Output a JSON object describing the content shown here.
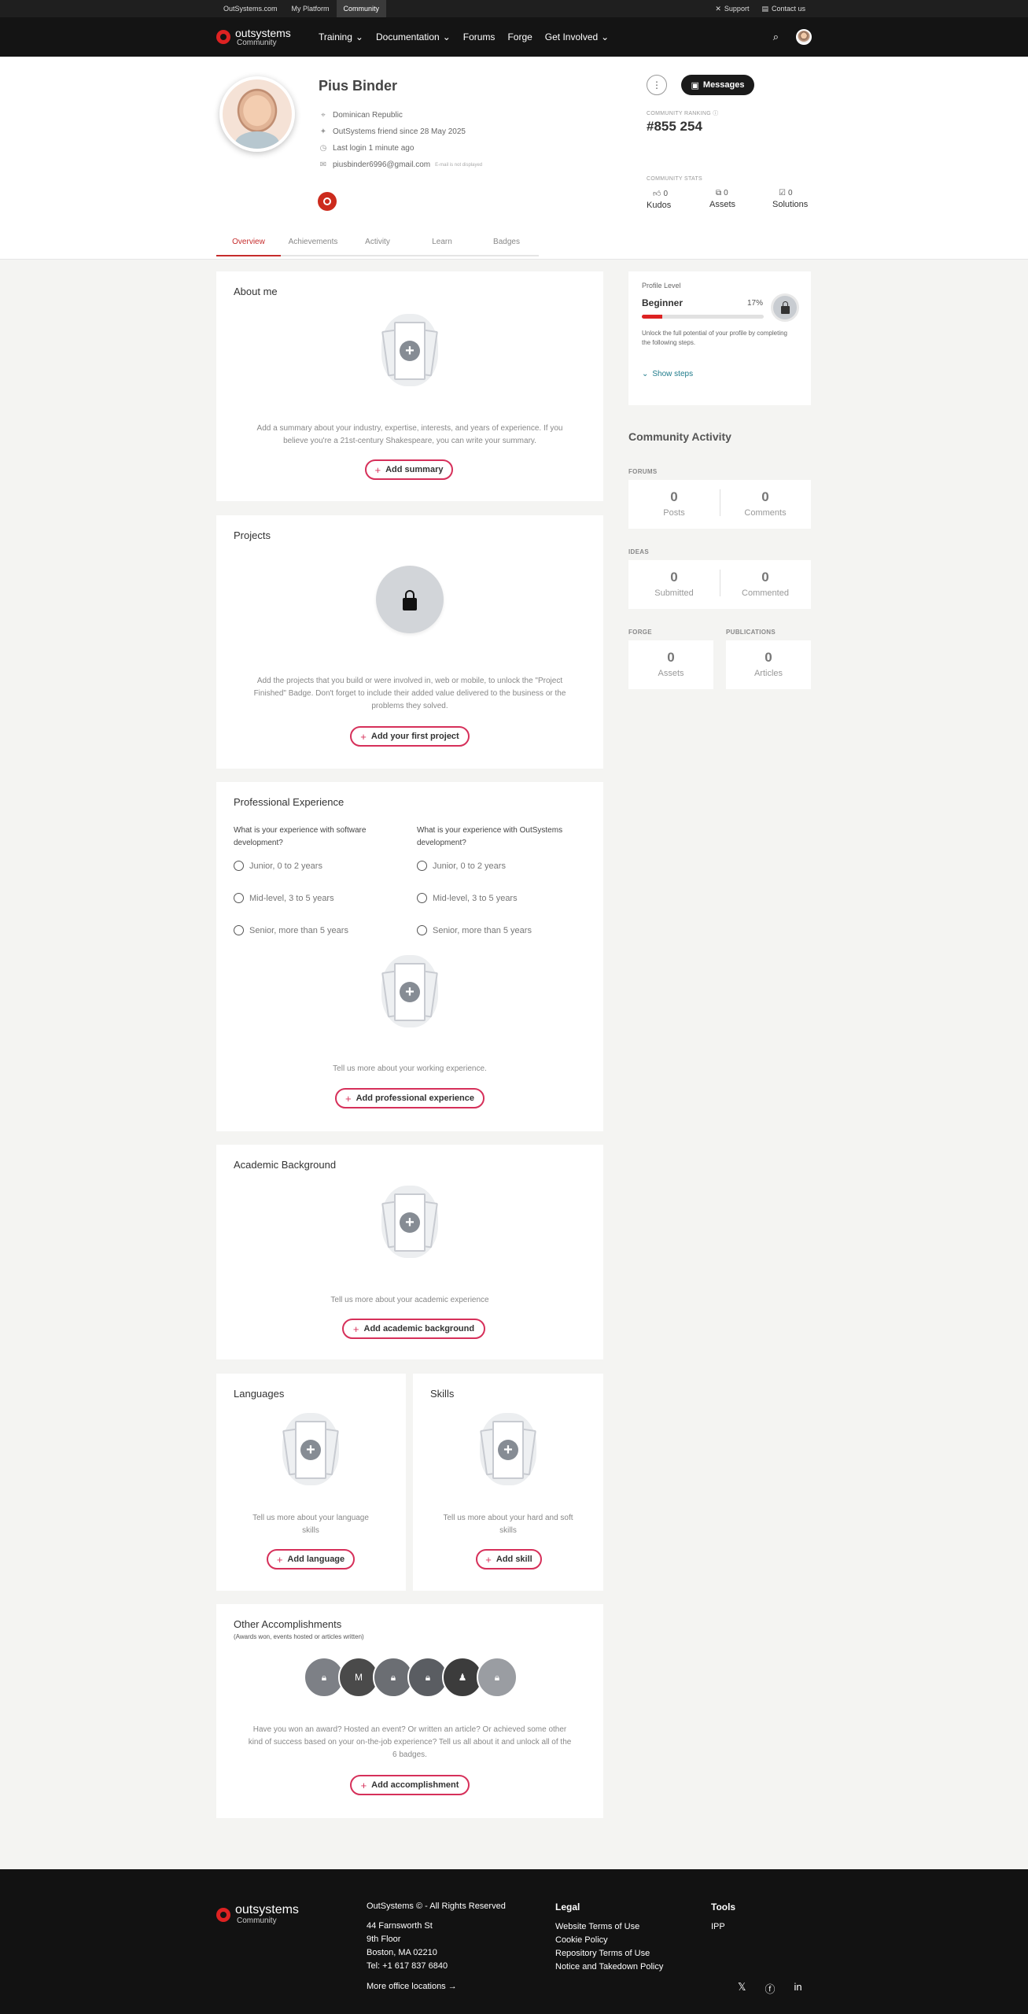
{
  "topbar": {
    "links": [
      "OutSystems.com",
      "My Platform",
      "Community"
    ],
    "right": [
      "Support",
      "Contact us"
    ]
  },
  "nav": {
    "brand": "outsystems",
    "brand_sub": "Community",
    "items": [
      "Training",
      "Documentation",
      "Forums",
      "Forge",
      "Get Involved"
    ]
  },
  "profile": {
    "name": "Pius Binder",
    "country": "Dominican Republic",
    "since": "OutSystems friend since 28 May 2025",
    "last_login": "Last login 1 minute ago",
    "email": "piusbinder6996@gmail.com",
    "email_note": "E-mail is not displayed",
    "messages_label": "Messages",
    "ranking_label": "COMMUNITY RANKING",
    "ranking": "#855 254",
    "stats_label": "COMMUNITY STATS",
    "stats": [
      {
        "count": "0",
        "label": "Kudos"
      },
      {
        "count": "0",
        "label": "Assets"
      },
      {
        "count": "0",
        "label": "Solutions"
      }
    ]
  },
  "tabs": [
    "Overview",
    "Achievements",
    "Activity",
    "Learn",
    "Badges"
  ],
  "about": {
    "title": "About me",
    "desc": "Add a summary about your industry, expertise, interests, and years of experience. If you believe you're a 21st-century Shakespeare, you can write your summary.",
    "button": "Add summary"
  },
  "projects": {
    "title": "Projects",
    "desc": "Add the projects that you build or were involved in, web or mobile, to unlock the \"Project Finished\" Badge. Don't forget to include their added value delivered to the business or the problems they solved.",
    "button": "Add your first project"
  },
  "experience": {
    "title": "Professional Experience",
    "q1": "What is your experience with software development?",
    "q2": "What is your experience with OutSystems development?",
    "options": [
      "Junior, 0 to 2 years",
      "Mid-level, 3 to 5 years",
      "Senior, more than 5 years"
    ],
    "desc": "Tell us more about your working experience.",
    "button": "Add professional experience"
  },
  "academic": {
    "title": "Academic Background",
    "desc": "Tell us more about your academic experience",
    "button": "Add academic background"
  },
  "languages": {
    "title": "Languages",
    "desc": "Tell us more about your language skills",
    "button": "Add language"
  },
  "skills": {
    "title": "Skills",
    "desc": "Tell us more about your hard and soft skills",
    "button": "Add skill"
  },
  "accomplishments": {
    "title": "Other Accomplishments",
    "sub": "(Awards won, events hosted or articles written)",
    "desc": "Have you won an award? Hosted an event? Or written an article? Or achieved some other kind of success based on your on-the-job experience? Tell us all about it and unlock all of the 6 badges.",
    "button": "Add accomplishment"
  },
  "profile_level": {
    "label": "Profile Level",
    "level": "Beginner",
    "percent": "17%",
    "progress": 0.17,
    "desc": "Unlock the full potential of your profile by completing the following steps.",
    "show_steps": "Show steps"
  },
  "community_activity": {
    "title": "Community Activity",
    "forums_label": "FORUMS",
    "forums": [
      {
        "n": "0",
        "l": "Posts"
      },
      {
        "n": "0",
        "l": "Comments"
      }
    ],
    "ideas_label": "IDEAS",
    "ideas": [
      {
        "n": "0",
        "l": "Submitted"
      },
      {
        "n": "0",
        "l": "Commented"
      }
    ],
    "forge_label": "FORGE",
    "forge": {
      "n": "0",
      "l": "Assets"
    },
    "publications_label": "PUBLICATIONS",
    "publications": {
      "n": "0",
      "l": "Articles"
    }
  },
  "footer": {
    "brand": "outsystems",
    "brand_sub": "Community",
    "copyright": "OutSystems © - All Rights Reserved",
    "address": [
      "44 Farnsworth St",
      "9th Floor",
      "Boston, MA 02210",
      "Tel: +1 617 837 6840"
    ],
    "more": "More office locations →",
    "legal_title": "Legal",
    "legal": [
      "Website Terms of Use",
      "Cookie Policy",
      "Repository Terms of Use",
      "Notice and Takedown Policy"
    ],
    "tools_title": "Tools",
    "tools": [
      "IPP"
    ]
  },
  "colors": {
    "accent": "#d6305a",
    "brand": "#cc2b1d",
    "dark": "#141414"
  }
}
